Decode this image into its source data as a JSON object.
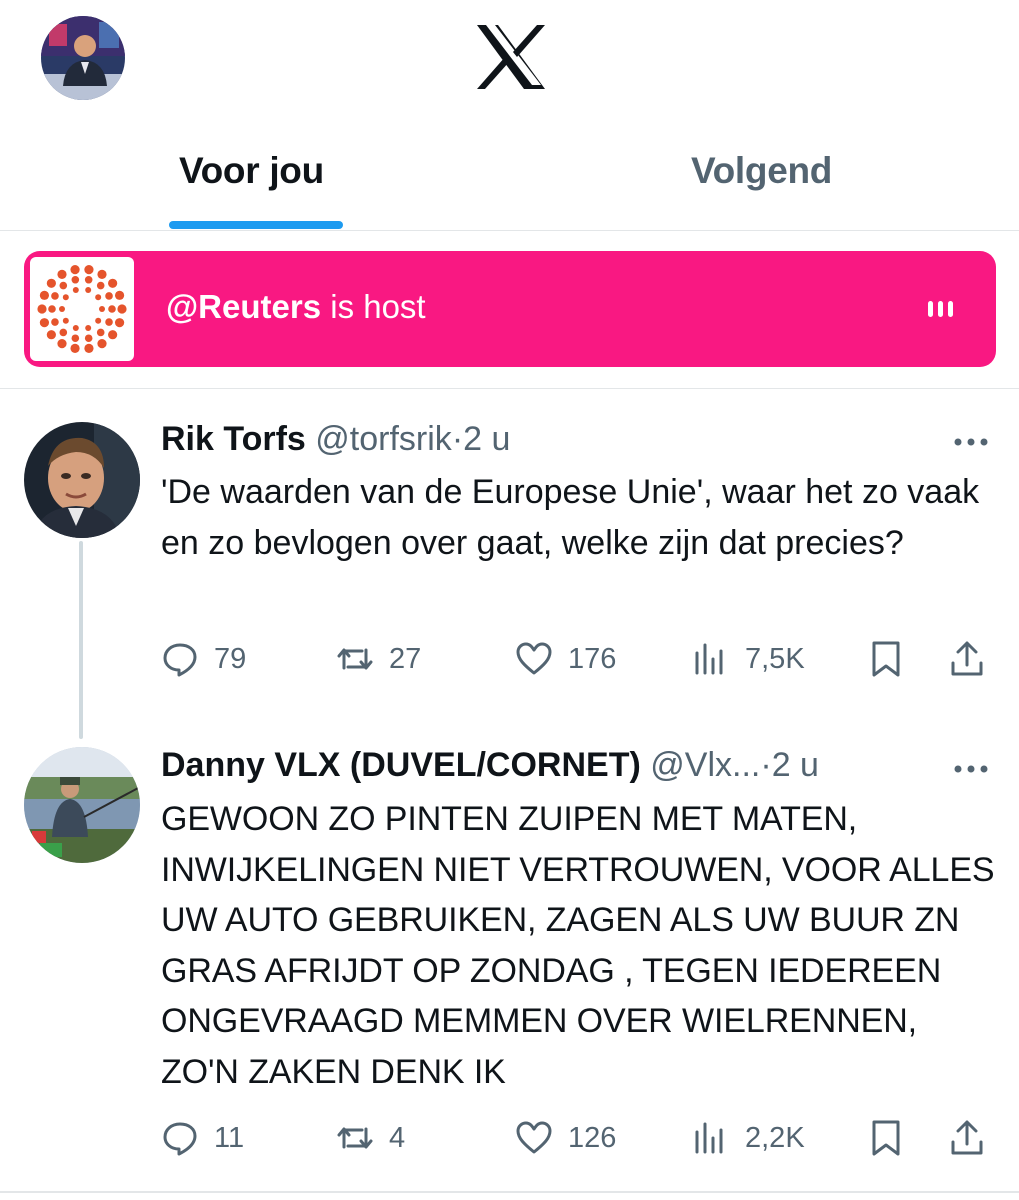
{
  "header": {
    "avatar": "profile-avatar",
    "logo": "x-logo-icon"
  },
  "tabs": [
    {
      "label": "Voor jou",
      "active": true
    },
    {
      "label": "Volgend",
      "active": false
    }
  ],
  "space": {
    "host": "@Reuters",
    "suffix": " is host",
    "color": "#f91882"
  },
  "tweets": [
    {
      "name": "Rik Torfs",
      "handle": "@torfsrik",
      "sep": "·",
      "time": "2 u",
      "text": "'De waarden van de Europese Unie', waar het zo vaak en zo bevlogen over gaat, welke zijn dat precies?",
      "replies": "79",
      "reposts": "27",
      "likes": "176",
      "views": "7,5K"
    },
    {
      "name": "Danny VLX (DUVEL/CORNET)",
      "handle": "@Vlx...",
      "sep": "·",
      "time": "2 u",
      "text": "GEWOON ZO PINTEN ZUIPEN MET MATEN, INWIJKELINGEN NIET VERTROUWEN, VOOR ALLES UW AUTO GEBRUIKEN, ZAGEN ALS UW BUUR ZN GRAS AFRIJDT OP ZONDAG , TEGEN IEDEREEN ONGEVRAAGD MEMMEN OVER WIELRENNEN, ZO'N ZAKEN DENK IK",
      "replies": "11",
      "reposts": "4",
      "likes": "126",
      "views": "2,2K"
    }
  ]
}
